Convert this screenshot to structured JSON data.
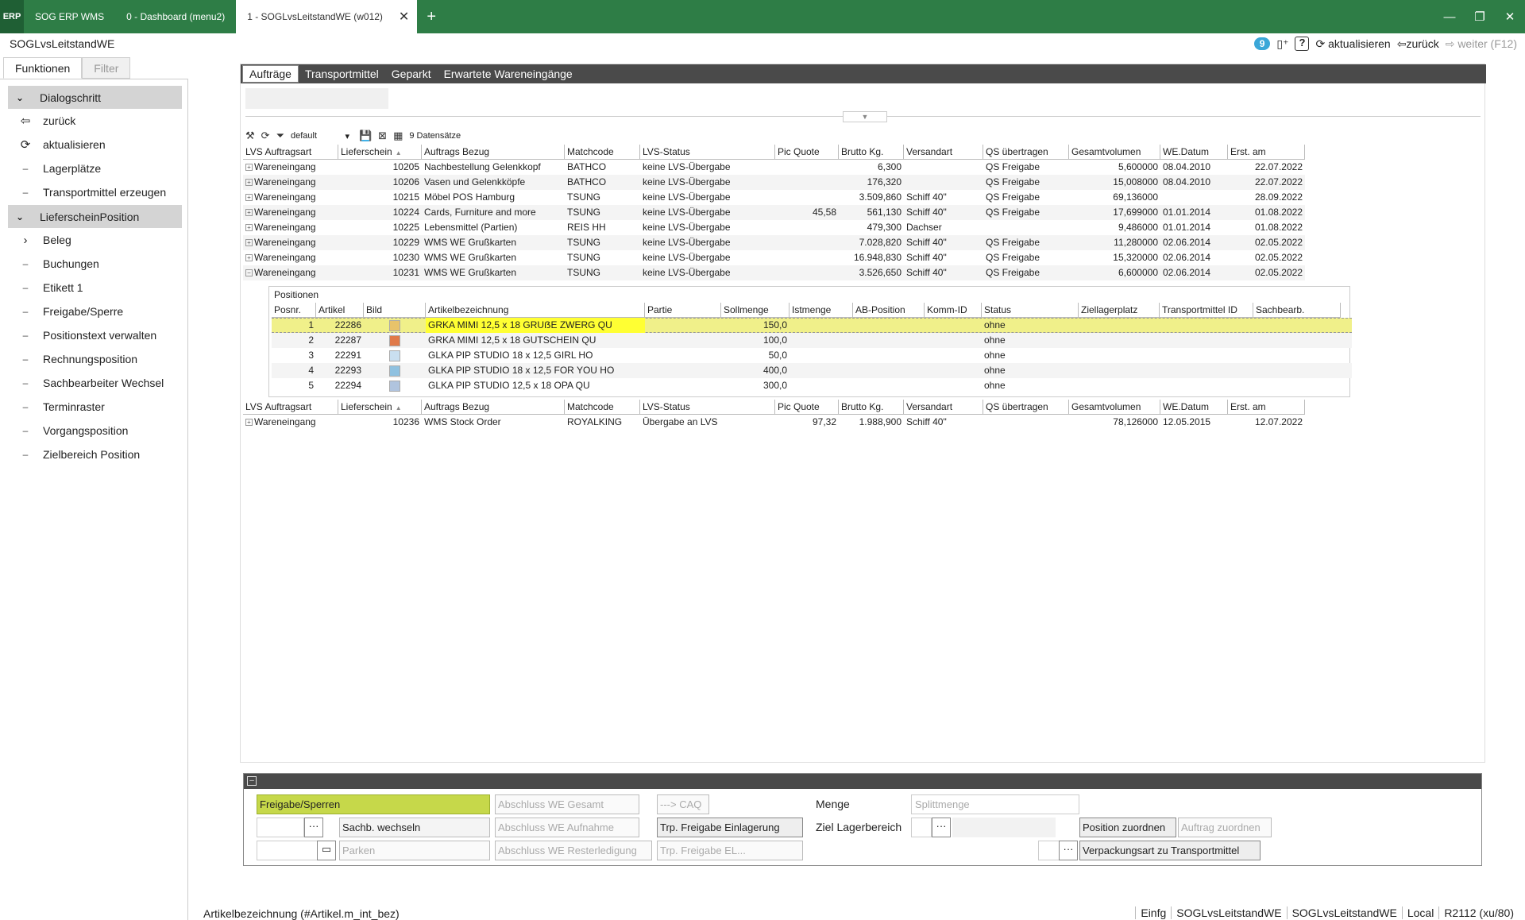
{
  "titlebar": {
    "logo": "ERP",
    "tabs": [
      {
        "label": "SOG ERP WMS"
      },
      {
        "label": "0 - Dashboard (menu2)"
      },
      {
        "label": "1 - SOGLvsLeitstandWE (w012)"
      }
    ],
    "close": "✕",
    "add": "+",
    "controls": [
      "—",
      "❐",
      "✕"
    ]
  },
  "header": {
    "app_title": "SOGLvsLeitstandWE",
    "badge": "9",
    "help": "?",
    "refresh_label": "aktualisieren",
    "back_label": "zurück",
    "forward_label": "weiter (F12)"
  },
  "left": {
    "tabs": [
      "Funktionen",
      "Filter"
    ],
    "group1": "Dialogschritt",
    "group1_items": [
      {
        "label": "zurück",
        "icon": "back-arrow-icon"
      },
      {
        "label": "aktualisieren",
        "icon": "refresh-icon"
      },
      {
        "label": "Lagerplätze",
        "icon": "dash-icon"
      },
      {
        "label": "Transportmittel erzeugen",
        "icon": "dash-icon"
      }
    ],
    "group2": "LieferscheinPosition",
    "group2_items": [
      {
        "label": "Beleg",
        "icon": "chevron-right-icon"
      },
      {
        "label": "Buchungen",
        "icon": "dash-icon"
      },
      {
        "label": "Etikett 1",
        "icon": "dash-icon"
      },
      {
        "label": "Freigabe/Sperre",
        "icon": "dash-icon"
      },
      {
        "label": "Positionstext verwalten",
        "icon": "dash-icon"
      },
      {
        "label": "Rechnungsposition",
        "icon": "dash-icon"
      },
      {
        "label": "Sachbearbeiter Wechsel",
        "icon": "dash-icon"
      },
      {
        "label": "Terminraster",
        "icon": "dash-icon"
      },
      {
        "label": "Vorgangsposition",
        "icon": "dash-icon"
      },
      {
        "label": "Zielbereich Position",
        "icon": "dash-icon"
      }
    ]
  },
  "main": {
    "tabs": [
      "Aufträge",
      "Transportmittel",
      "Geparkt",
      "Erwartete Wareneingänge"
    ],
    "toolbar": {
      "layout": "default",
      "count": "9 Datensätze"
    },
    "columns": [
      "LVS Auftragsart",
      "Lieferschein",
      "Auftrags Bezug",
      "Matchcode",
      "LVS-Status",
      "Pic Quote",
      "Brutto Kg.",
      "Versandart",
      "QS übertragen",
      "Gesamtvolumen",
      "WE.Datum",
      "Erst. am"
    ],
    "rows": [
      [
        "Wareneingang",
        "10205",
        "Nachbestellung Gelenkkopf",
        "BATHCO",
        "keine LVS-Übergabe",
        "",
        "6,300",
        "",
        "QS Freigabe",
        "5,600000",
        "08.04.2010",
        "22.07.2022"
      ],
      [
        "Wareneingang",
        "10206",
        "Vasen und Gelenkköpfe",
        "BATHCO",
        "keine LVS-Übergabe",
        "",
        "176,320",
        "",
        "QS Freigabe",
        "15,008000",
        "08.04.2010",
        "22.07.2022"
      ],
      [
        "Wareneingang",
        "10215",
        "Möbel POS Hamburg",
        "TSUNG",
        "keine LVS-Übergabe",
        "",
        "3.509,860",
        "Schiff 40\"",
        "QS Freigabe",
        "69,136000",
        "",
        "28.09.2022"
      ],
      [
        "Wareneingang",
        "10224",
        "Cards, Furniture and more",
        "TSUNG",
        "keine LVS-Übergabe",
        "45,58",
        "561,130",
        "Schiff 40\"",
        "QS Freigabe",
        "17,699000",
        "01.01.2014",
        "01.08.2022"
      ],
      [
        "Wareneingang",
        "10225",
        "Lebensmittel (Partien)",
        "REIS HH",
        "keine LVS-Übergabe",
        "",
        "479,300",
        "Dachser",
        "",
        "9,486000",
        "01.01.2014",
        "01.08.2022"
      ],
      [
        "Wareneingang",
        "10229",
        "WMS WE Grußkarten",
        "TSUNG",
        "keine LVS-Übergabe",
        "",
        "7.028,820",
        "Schiff 40\"",
        "QS Freigabe",
        "11,280000",
        "02.06.2014",
        "02.05.2022"
      ],
      [
        "Wareneingang",
        "10230",
        "WMS WE Grußkarten",
        "TSUNG",
        "keine LVS-Übergabe",
        "",
        "16.948,830",
        "Schiff 40\"",
        "QS Freigabe",
        "15,320000",
        "02.06.2014",
        "02.05.2022"
      ],
      [
        "Wareneingang",
        "10231",
        "WMS WE Grußkarten",
        "TSUNG",
        "keine LVS-Übergabe",
        "",
        "3.526,650",
        "Schiff 40\"",
        "QS Freigabe",
        "6,600000",
        "02.06.2014",
        "02.05.2022"
      ]
    ],
    "last_row": [
      "Wareneingang",
      "10236",
      "WMS Stock Order",
      "ROYALKING",
      "Übergabe an LVS",
      "97,32",
      "1.988,900",
      "Schiff 40\"",
      "",
      "78,126000",
      "12.05.2015",
      "12.07.2022"
    ],
    "positions": {
      "title": "Positionen",
      "columns": [
        "Posnr.",
        "Artikel",
        "Bild",
        "Artikelbezeichnung",
        "Partie",
        "Sollmenge",
        "Istmenge",
        "AB-Position",
        "Komm-ID",
        "Status",
        "Ziellagerplatz",
        "Transportmittel ID",
        "Sachbearb."
      ],
      "rows": [
        [
          "1",
          "22286",
          "GRKA MIMI 12,5 x 18 GRUẞE ZWERG QU",
          "150,0",
          "ohne"
        ],
        [
          "2",
          "22287",
          "GRKA MIMI 12,5 x 18 GUTSCHEIN QU",
          "100,0",
          "ohne"
        ],
        [
          "3",
          "22291",
          "GLKA PIP STUDIO 18 x 12,5 GIRL HO",
          "50,0",
          "ohne"
        ],
        [
          "4",
          "22293",
          "GLKA PIP STUDIO 18 x 12,5 FOR YOU HO",
          "400,0",
          "ohne"
        ],
        [
          "5",
          "22294",
          "GLKA PIP STUDIO 12,5 x 18 OPA QU",
          "300,0",
          "ohne"
        ]
      ]
    }
  },
  "bottom": {
    "freigabe": "Freigabe/Sperren",
    "sachb": "Sachb. wechseln",
    "parken": "Parken",
    "abschluss_gesamt": "Abschluss WE Gesamt",
    "abschluss_aufnahme": "Abschluss WE Aufnahme",
    "abschluss_rest": "Abschluss WE Resterledigung",
    "caq": "---> CAQ",
    "trp_einlagerung": "Trp. Freigabe Einlagerung",
    "trp_el": "Trp. Freigabe EL...",
    "menge": "Menge",
    "splitt_placeholder": "Splittmenge",
    "ziel": "Ziel Lagerbereich",
    "pos_zuordnen": "Position zuordnen",
    "auftrag_zuordnen": "Auftrag zuordnen",
    "verpackung": "Verpackungsart zu Transportmittel",
    "dots": "···"
  },
  "status": {
    "left": "Artikelbezeichnung (#Artikel.m_int_bez)",
    "right": [
      "Einfg",
      "SOGLvsLeitstandWE",
      "SOGLvsLeitstandWE",
      "Local",
      "R2112 (xu/80)"
    ]
  }
}
